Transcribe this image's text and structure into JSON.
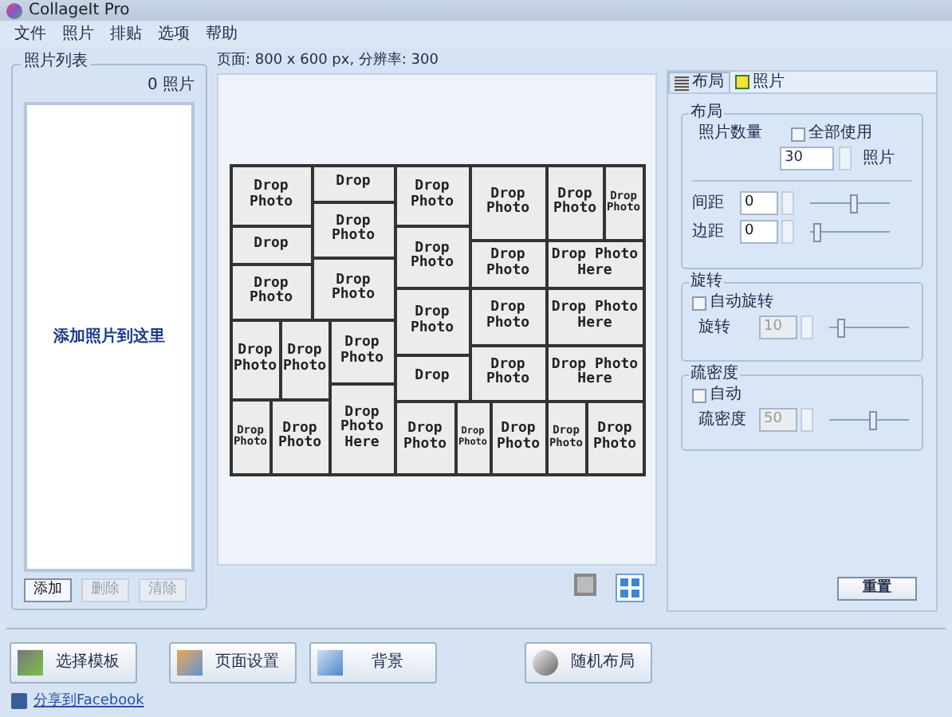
{
  "window": {
    "title": "CollageIt Pro"
  },
  "menu": [
    "文件",
    "照片",
    "排贴",
    "选项",
    "帮助"
  ],
  "photo_list": {
    "title": "照片列表",
    "count": "0 照片",
    "hint": "添加照片到这里",
    "buttons": [
      {
        "label": "添加",
        "disabled": false
      },
      {
        "label": "删除",
        "disabled": true
      },
      {
        "label": "清除",
        "disabled": true
      }
    ]
  },
  "page_info": "页面: 800 x 600 px, 分辨率: 300",
  "collage": {
    "cells": [
      "Drop Photo",
      "Drop",
      "Drop Photo",
      "Drop Photo",
      "Drop Photo",
      "Drop Photo",
      "Drop Photo",
      "Drop",
      "Drop Photo",
      "Drop Photo",
      "Drop Photo",
      "Drop Photo Here",
      "Drop Photo",
      "Drop Photo",
      "Drop Photo",
      "Drop",
      "Drop Photo",
      "Drop Photo",
      "Drop Photo",
      "Drop Photo",
      "Drop Photo",
      "Drop Photo",
      "Drop Photo",
      "Drop Photo",
      "Drop Photo",
      "Drop Photo Here",
      "Drop Photo Here",
      "Drop Photo Here",
      "Drop Photo",
      "Drop Photo"
    ]
  },
  "tabs": [
    {
      "label": "布局",
      "selected": true
    },
    {
      "label": "照片",
      "selected": false
    }
  ],
  "layout_group": {
    "title": "布局",
    "count_label": "照片数量",
    "use_all": {
      "label": "全部使用",
      "checked": false
    },
    "count": "30",
    "unit": "照片",
    "sliders": [
      {
        "label": "间距",
        "value": "0",
        "level": 0.55
      },
      {
        "label": "边距",
        "value": "0",
        "level": 0.05
      }
    ]
  },
  "rotation_group": {
    "title": "旋转",
    "auto": {
      "label": "自动旋转",
      "checked": false
    },
    "label": "旋转",
    "value": "10",
    "disabled": true,
    "level": 0.12
  },
  "density_group": {
    "title": "疏密度",
    "auto": {
      "label": "自动",
      "checked": false
    },
    "label": "疏密度",
    "value": "50",
    "disabled": true,
    "level": 0.55
  },
  "reset": "重置",
  "bottom_buttons": [
    {
      "label": "选择模板",
      "kind": "template"
    },
    {
      "label": "页面设置",
      "kind": "page"
    },
    {
      "label": "背景",
      "kind": "background"
    },
    {
      "label": "随机布局",
      "kind": "random"
    }
  ],
  "share_link": "分享到Facebook"
}
